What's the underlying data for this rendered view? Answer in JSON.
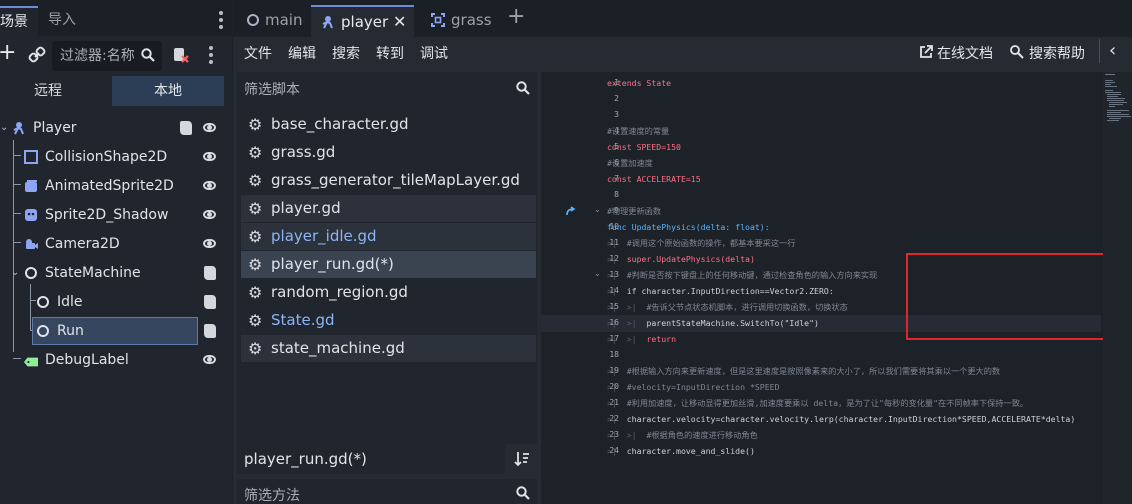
{
  "left_dock": {
    "tabs": [
      "场景",
      "导入"
    ],
    "filter_placeholder": "过滤器:名称",
    "remote_label": "远程",
    "local_label": "本地",
    "nodes": [
      {
        "label": "Player",
        "icon": "character-body-icon"
      },
      {
        "label": "CollisionShape2D",
        "icon": "collision-shape-icon"
      },
      {
        "label": "AnimatedSprite2D",
        "icon": "animated-sprite-icon"
      },
      {
        "label": "Sprite2D_Shadow",
        "icon": "sprite-icon"
      },
      {
        "label": "Camera2D",
        "icon": "camera-icon"
      },
      {
        "label": "StateMachine",
        "icon": "node-icon"
      },
      {
        "label": "Idle",
        "icon": "node-icon"
      },
      {
        "label": "Run",
        "icon": "node-icon"
      },
      {
        "label": "DebugLabel",
        "icon": "label-icon"
      }
    ]
  },
  "tabs": [
    {
      "label": "main",
      "icon": "circle-icon"
    },
    {
      "label": "player",
      "icon": "character-body-icon",
      "active": true
    },
    {
      "label": "grass",
      "icon": "frame-icon"
    }
  ],
  "menu": {
    "items": [
      "文件",
      "编辑",
      "搜索",
      "转到",
      "调试"
    ],
    "online_docs": "在线文档",
    "search_help": "搜索帮助"
  },
  "script_panel": {
    "filter_placeholder": "筛选脚本",
    "scripts": [
      {
        "name": "base_character.gd"
      },
      {
        "name": "grass.gd"
      },
      {
        "name": "grass_generator_tileMapLayer.gd"
      },
      {
        "name": "player.gd"
      },
      {
        "name": "player_idle.gd"
      },
      {
        "name": "player_run.gd(*)"
      },
      {
        "name": "random_region.gd"
      },
      {
        "name": "State.gd"
      },
      {
        "name": "state_machine.gd"
      }
    ],
    "current_script": "player_run.gd(*)",
    "method_filter_placeholder": "筛选方法"
  },
  "editor": {
    "line_numbers": [
      "1",
      "2",
      "3",
      "4",
      "5",
      "6",
      "7",
      "8",
      "9",
      "10",
      "11",
      "12",
      "13",
      "14",
      "15",
      "16",
      "17",
      "18",
      "19",
      "20",
      "21",
      "22",
      "23",
      "24"
    ],
    "lines": [
      "extends State",
      "",
      "",
      "#设置速度的常量",
      "const SPEED=150",
      "#设置加速度",
      "const ACCELERATE=15",
      "",
      "#物理更新函数",
      "func UpdatePhysics(delta: float):",
      "\t#调用这个原始函数的操作，都基本要采这一行",
      "\tsuper.UpdatePhysics(delta)",
      "\t#判断是否按下键盘上的任何移动键，通过检查角色的输入方向来实现",
      "\tif character.InputDirection==Vector2.ZERO:",
      "\t\t#告诉父节点状态机脚本，进行调用切换函数，切换状态",
      "\t\tparentStateMachine.SwitchTo(\"Idle\")",
      "\t\treturn",
      "",
      "\t#根据输入方向来更新速度，但是这里速度是按照像素来的大小了，所以我们需要将其乘以一个更大的数",
      "\t#velocity=InputDirection *SPEED",
      "\t#利用加速度，让移动显得更加丝滑,加速度要乘以 delta，是为了让\"每秒的变化量\"在不同帧率下保持一致。",
      "\tcharacter.velocity=character.velocity.lerp(character.InputDirection*SPEED,ACCELERATE*delta)",
      "\t\t#根据角色的速度进行移动角色",
      "\tcharacter.move_and_slide()"
    ]
  }
}
